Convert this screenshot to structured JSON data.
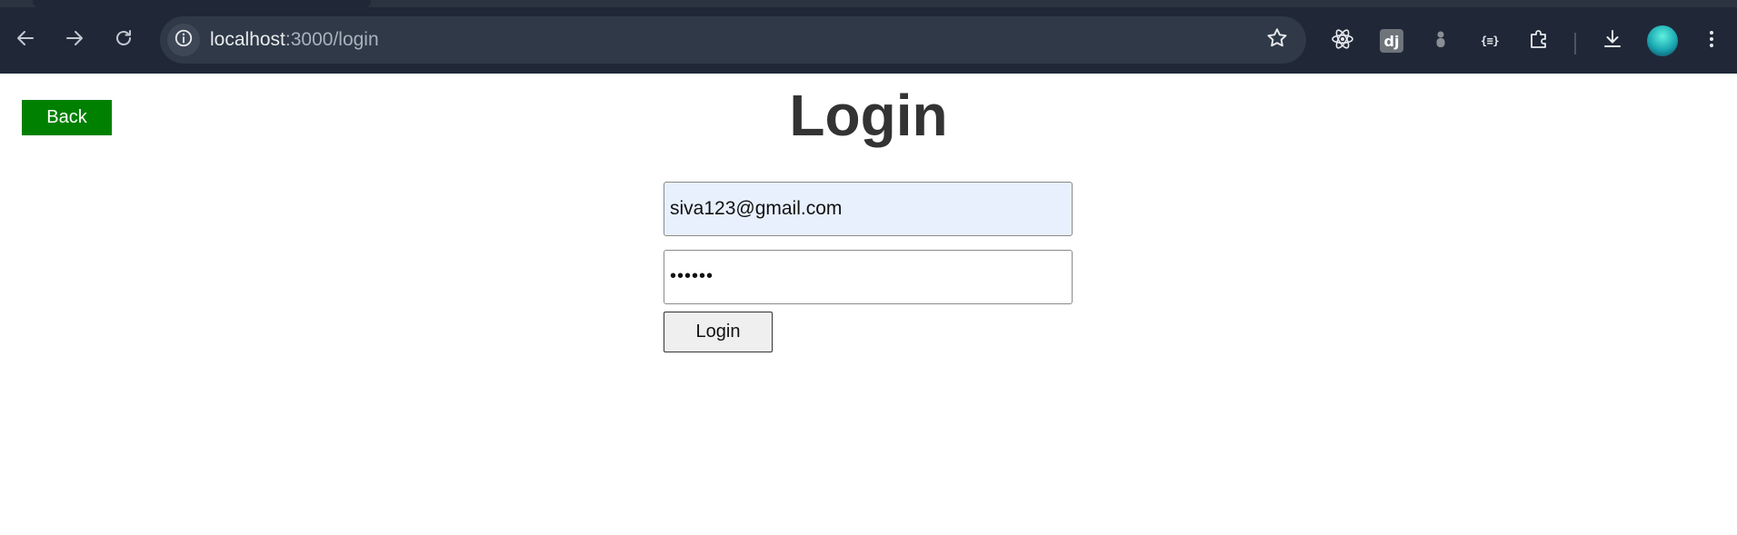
{
  "browser": {
    "url_host": "localhost",
    "url_path": ":3000/login",
    "icons": {
      "back": "arrow-left-icon",
      "forward": "arrow-right-icon",
      "reload": "reload-icon",
      "site_info": "info-icon",
      "bookmark": "star-icon",
      "react_devtools": "react-atom-icon",
      "django": "django-icon",
      "ext_gray": "extension-figure-icon",
      "json_viewer": "json-braces-icon",
      "extensions": "puzzle-icon",
      "downloads": "download-icon",
      "profile": "avatar",
      "menu": "kebab-menu-icon"
    },
    "django_label": "dj",
    "json_label": "{≡}"
  },
  "page": {
    "back_label": "Back",
    "title": "Login",
    "email_value": "siva123@gmail.com",
    "password_value": "••••••",
    "login_label": "Login",
    "colors": {
      "back_button_bg": "#008000",
      "title": "#333333",
      "autofill_bg": "#e8f0fe"
    }
  }
}
